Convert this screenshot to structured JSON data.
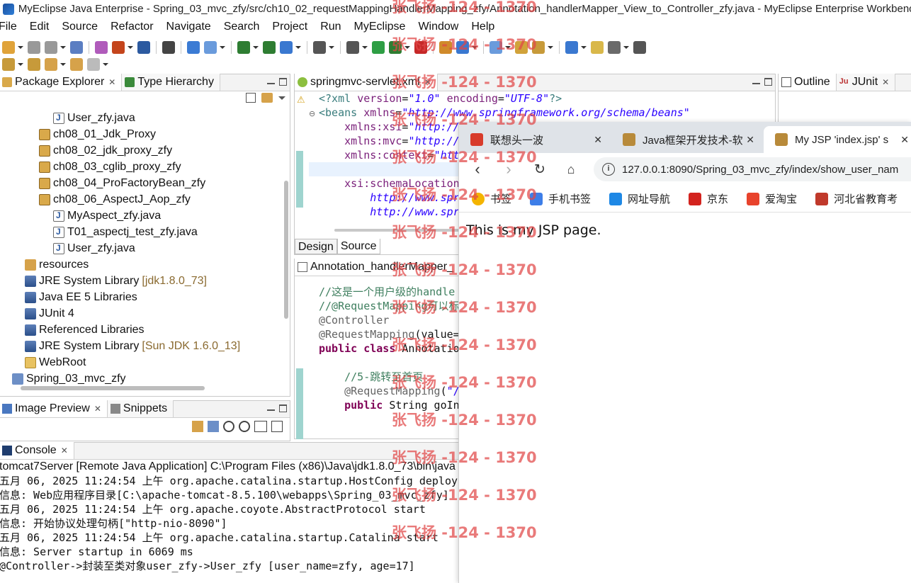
{
  "window": {
    "title": "MyEclipse Java Enterprise - Spring_03_mvc_zfy/src/ch10_02_requestMappingHandlerMapping_zfy/Annotation_handlerMapper_View_to_Controller_zfy.java - MyEclipse Enterprise Workbench"
  },
  "menu": [
    "File",
    "Edit",
    "Source",
    "Refactor",
    "Navigate",
    "Search",
    "Project",
    "Run",
    "MyEclipse",
    "Window",
    "Help"
  ],
  "package_explorer": {
    "tabs": [
      "Package Explorer",
      "Type Hierarchy"
    ],
    "items": [
      {
        "label": "User_zfy.java",
        "icon": "java-file-icon",
        "extra": ""
      },
      {
        "label": "ch08_01_Jdk_Proxy",
        "icon": "package-icon",
        "extra": ""
      },
      {
        "label": "ch08_02_jdk_proxy_zfy",
        "icon": "package-icon",
        "extra": ""
      },
      {
        "label": "ch08_03_cglib_proxy_zfy",
        "icon": "package-icon",
        "extra": ""
      },
      {
        "label": "ch08_04_ProFactoryBean_zfy",
        "icon": "package-icon",
        "extra": ""
      },
      {
        "label": "ch08_06_AspectJ_Aop_zfy",
        "icon": "package-icon",
        "extra": ""
      },
      {
        "label": "MyAspect_zfy.java",
        "icon": "java-file-icon",
        "extra": ""
      },
      {
        "label": "T01_aspectj_test_zfy.java",
        "icon": "java-file-icon",
        "extra": ""
      },
      {
        "label": "User_zfy.java",
        "icon": "java-file-icon",
        "extra": ""
      },
      {
        "label": "resources",
        "icon": "resources-icon",
        "extra": ""
      },
      {
        "label": "JRE System Library",
        "icon": "library-icon",
        "extra": "[jdk1.8.0_73]"
      },
      {
        "label": "Java EE 5 Libraries",
        "icon": "library-icon",
        "extra": ""
      },
      {
        "label": "JUnit 4",
        "icon": "library-icon",
        "extra": ""
      },
      {
        "label": "Referenced Libraries",
        "icon": "library-icon",
        "extra": ""
      },
      {
        "label": "JRE System Library",
        "icon": "library-icon",
        "extra": "[Sun JDK 1.6.0_13]"
      },
      {
        "label": "WebRoot",
        "icon": "folder-icon",
        "extra": ""
      },
      {
        "label": "Spring_03_mvc_zfy",
        "icon": "project-icon",
        "extra": ""
      }
    ]
  },
  "xml_editor": {
    "tab": "springmvc-servlet.xml",
    "lines": [
      [
        {
          "t": "<?xml ",
          "c": "xml-tag"
        },
        {
          "t": "version",
          "c": "xml-attr"
        },
        {
          "t": "=",
          "c": ""
        },
        {
          "t": "\"1.0\"",
          "c": "xml-str"
        },
        {
          "t": " encoding",
          "c": "xml-attr"
        },
        {
          "t": "=",
          "c": ""
        },
        {
          "t": "\"UTF-8\"",
          "c": "xml-str"
        },
        {
          "t": "?>",
          "c": "xml-tag"
        }
      ],
      [
        {
          "t": "<beans",
          "c": "xml-tag"
        },
        {
          "t": " xmlns",
          "c": "xml-attr"
        },
        {
          "t": "=",
          "c": ""
        },
        {
          "t": "\"http://www.springframework.org/schema/beans\"",
          "c": "xml-str"
        }
      ],
      [
        {
          "t": "    xmlns:xsi",
          "c": "xml-attr"
        },
        {
          "t": "=",
          "c": ""
        },
        {
          "t": "\"http://",
          "c": "xml-str"
        }
      ],
      [
        {
          "t": "    xmlns:mvc",
          "c": "xml-attr"
        },
        {
          "t": "=",
          "c": ""
        },
        {
          "t": "\"http://",
          "c": "xml-str"
        }
      ],
      [
        {
          "t": "    xmlns:context",
          "c": "xml-attr"
        },
        {
          "t": "=",
          "c": ""
        },
        {
          "t": "\"htt",
          "c": "xml-str"
        }
      ],
      [
        {
          "t": "",
          "c": ""
        }
      ],
      [
        {
          "t": "    xsi:schemaLocation",
          "c": "xml-attr"
        },
        {
          "t": "=",
          "c": ""
        }
      ],
      [
        {
          "t": "        http://www.spr",
          "c": "xml-str"
        }
      ],
      [
        {
          "t": "        http://www.spr",
          "c": "xml-str"
        }
      ]
    ],
    "bottom_tabs": [
      "Design",
      "Source"
    ]
  },
  "java_editor": {
    "tab": "Annotation_handlerMapper_",
    "lines": [
      [
        {
          "t": "//这是一个用户级的handle",
          "c": "cm"
        }
      ],
      [
        {
          "t": "//@RequestMapping可以标",
          "c": "cm"
        }
      ],
      [
        {
          "t": "@Controller",
          "c": "ann"
        }
      ],
      [
        {
          "t": "@RequestMapping",
          "c": "ann"
        },
        {
          "t": "(value=",
          "c": ""
        },
        {
          "t": "\"",
          "c": "str"
        }
      ],
      [
        {
          "t": "public class ",
          "c": "kw"
        },
        {
          "t": "Annotation",
          "c": ""
        }
      ],
      [
        {
          "t": "",
          "c": ""
        }
      ],
      [
        {
          "t": "    //5-跳转至首页",
          "c": "cm"
        }
      ],
      [
        {
          "t": "    @RequestMapping",
          "c": "ann"
        },
        {
          "t": "(",
          "c": ""
        },
        {
          "t": "\"/s",
          "c": "str"
        }
      ],
      [
        {
          "t": "    public ",
          "c": "kw"
        },
        {
          "t": "String goInd",
          "c": ""
        }
      ]
    ]
  },
  "outline": {
    "tabs": [
      "Outline",
      "JUnit"
    ]
  },
  "image_preview": {
    "tabs": [
      "Image Preview",
      "Snippets"
    ]
  },
  "console": {
    "tab": "Console",
    "header": "tomcat7Server [Remote Java Application] C:\\Program Files (x86)\\Java\\jdk1.8.0_73\\bin\\java",
    "lines": [
      "五月 06, 2025 11:24:54 上午 org.apache.catalina.startup.HostConfig deployD",
      "信息: Web应用程序目录[C:\\apache-tomcat-8.5.100\\webapps\\Spring_03_mvc_zfy]",
      "五月 06, 2025 11:24:54 上午 org.apache.coyote.AbstractProtocol start",
      "信息: 开始协议处理句柄[\"http-nio-8090\"]",
      "五月 06, 2025 11:24:54 上午 org.apache.catalina.startup.Catalina start",
      "信息: Server startup in 6069 ms",
      "@Controller->封装至类对象user_zfy->User_zfy [user_name=zfy, age=17]"
    ]
  },
  "browser": {
    "tabs": [
      {
        "title": "联想头一波",
        "favicon_color": "#d83b2b"
      },
      {
        "title": "Java框架开发技术-软",
        "favicon_color": "#b88a3a"
      },
      {
        "title": "My JSP 'index.jsp' s",
        "favicon_color": "#b88a3a"
      }
    ],
    "url": "127.0.0.1:8090/Spring_03_mvc_zfy/index/show_user_nam",
    "bookmarks": [
      {
        "label": "书签",
        "color": "#f4b400"
      },
      {
        "label": "手机书签",
        "color": "#3d7ee8"
      },
      {
        "label": "网址导航",
        "color": "#1e88e5"
      },
      {
        "label": "京东",
        "color": "#d3231e"
      },
      {
        "label": "爱淘宝",
        "color": "#e8432c"
      },
      {
        "label": "河北省教育考",
        "color": "#c0392b"
      }
    ],
    "content": "This is my JSP page."
  },
  "watermark": "张飞扬 -124 - 1370"
}
